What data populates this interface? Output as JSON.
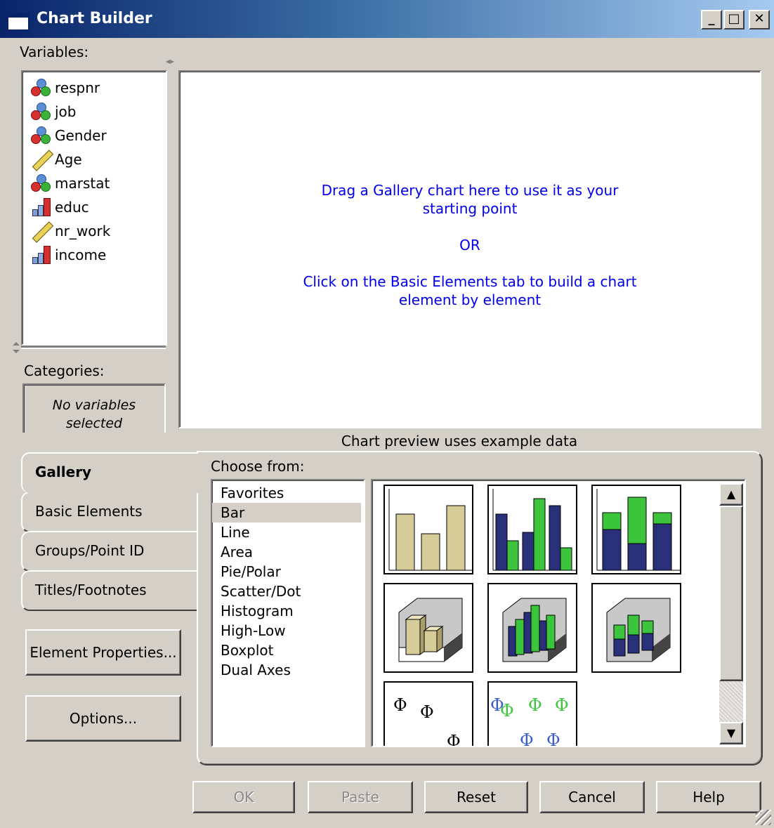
{
  "window": {
    "title": "Chart Builder",
    "controls": {
      "minimize": "_",
      "maximize": "□",
      "close": "✕"
    }
  },
  "variables": {
    "label": "Variables:",
    "items": [
      {
        "name": "respnr",
        "type": "nominal"
      },
      {
        "name": "job",
        "type": "nominal"
      },
      {
        "name": "Gender",
        "type": "nominal"
      },
      {
        "name": "Age",
        "type": "scale"
      },
      {
        "name": "marstat",
        "type": "nominal"
      },
      {
        "name": "educ",
        "type": "ordinal"
      },
      {
        "name": "nr_work",
        "type": "scale"
      },
      {
        "name": "income",
        "type": "ordinal"
      }
    ]
  },
  "categories": {
    "label": "Categories:",
    "empty_text_line1": "No variables",
    "empty_text_line2": "selected"
  },
  "canvas": {
    "line1": "Drag a Gallery chart here to use it as your",
    "line2": "starting point",
    "line3": "OR",
    "line4": "Click on the Basic Elements tab to build a chart",
    "line5": "element by element"
  },
  "preview_note": "Chart preview uses example data",
  "tabs": [
    {
      "label": "Gallery",
      "active": true
    },
    {
      "label": "Basic Elements",
      "active": false
    },
    {
      "label": "Groups/Point ID",
      "active": false
    },
    {
      "label": "Titles/Footnotes",
      "active": false
    }
  ],
  "side_buttons": {
    "element_properties": "Element Properties...",
    "options": "Options..."
  },
  "choose_from": {
    "label": "Choose from:",
    "items": [
      "Favorites",
      "Bar",
      "Line",
      "Area",
      "Pie/Polar",
      "Scatter/Dot",
      "Histogram",
      "High-Low",
      "Boxplot",
      "Dual Axes"
    ],
    "selected": "Bar"
  },
  "gallery_thumbnails": [
    {
      "icon": "simple-bar-chart-icon"
    },
    {
      "icon": "clustered-bar-chart-icon"
    },
    {
      "icon": "stacked-bar-chart-icon"
    },
    {
      "icon": "simple-3d-bar-chart-icon"
    },
    {
      "icon": "clustered-3d-bar-chart-icon"
    },
    {
      "icon": "stacked-3d-bar-chart-icon"
    },
    {
      "icon": "simple-error-bar-chart-icon"
    },
    {
      "icon": "clustered-error-bar-chart-icon"
    }
  ],
  "buttons": {
    "ok": "OK",
    "paste": "Paste",
    "reset": "Reset",
    "cancel": "Cancel",
    "help": "Help"
  },
  "colors": {
    "title_bar": "#0a246a",
    "face": "#d4d0c8",
    "link_text": "#0000ee",
    "bar_tan": "#d6cc99",
    "bar_navy": "#2a2f7a",
    "bar_green": "#3cc43c"
  }
}
